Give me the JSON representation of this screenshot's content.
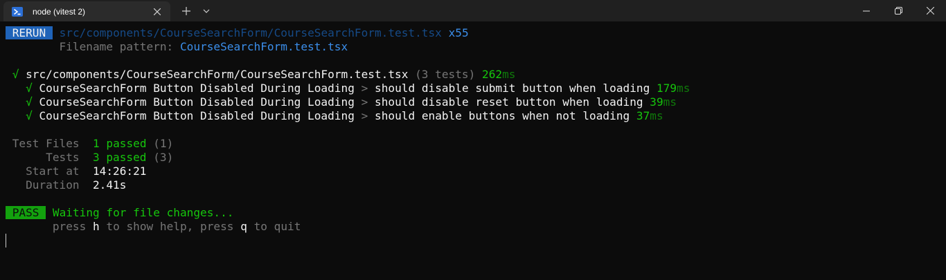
{
  "window": {
    "tab_title": "node (vitest 2)",
    "tab_icon": "powershell-icon",
    "new_tab_icon": "plus-icon",
    "dropdown_icon": "chevron-down-icon",
    "controls": [
      "minimize-icon",
      "maximize-icon",
      "close-icon"
    ]
  },
  "colors": {
    "background": "#0c0c0c",
    "titlebar": "#202020",
    "tab": "#2b2b2b",
    "rerun_badge": "#1f63b8",
    "pass_badge": "#13a10e",
    "green": "#16c60c",
    "blue": "#3b8eea",
    "gray": "#767676"
  },
  "terminal": {
    "rerun": {
      "badge": "RERUN",
      "path": "src/components/CourseSearchForm/CourseSearchForm.test.tsx",
      "count": "x55",
      "pattern_label": "Filename pattern:",
      "pattern_value": "CourseSearchForm.test.tsx"
    },
    "suite": {
      "check": "√",
      "file": "src/components/CourseSearchForm/CourseSearchForm.test.tsx",
      "tests_info": "(3 tests)",
      "duration": "262",
      "unit": "ms"
    },
    "tests": [
      {
        "check": "√",
        "group": "CourseSearchForm Button Disabled During Loading",
        "sep": ">",
        "name": "should disable submit button when loading",
        "duration": "179",
        "unit": "ms"
      },
      {
        "check": "√",
        "group": "CourseSearchForm Button Disabled During Loading",
        "sep": ">",
        "name": "should disable reset button when loading",
        "duration": "39",
        "unit": "ms"
      },
      {
        "check": "√",
        "group": "CourseSearchForm Button Disabled During Loading",
        "sep": ">",
        "name": "should enable buttons when not loading",
        "duration": "37",
        "unit": "ms"
      }
    ],
    "summary": {
      "test_files_label": "Test Files",
      "test_files_passed": "1 passed",
      "test_files_total": "(1)",
      "tests_label": "Tests",
      "tests_passed": "3 passed",
      "tests_total": "(3)",
      "start_label": "Start at",
      "start_value": "14:26:21",
      "duration_label": "Duration",
      "duration_value": "2.41s"
    },
    "status": {
      "badge": "PASS",
      "message": "Waiting for file changes...",
      "hint_press_1": "press",
      "hint_key_h": "h",
      "hint_mid": "to show help, press",
      "hint_key_q": "q",
      "hint_end": "to quit"
    }
  }
}
